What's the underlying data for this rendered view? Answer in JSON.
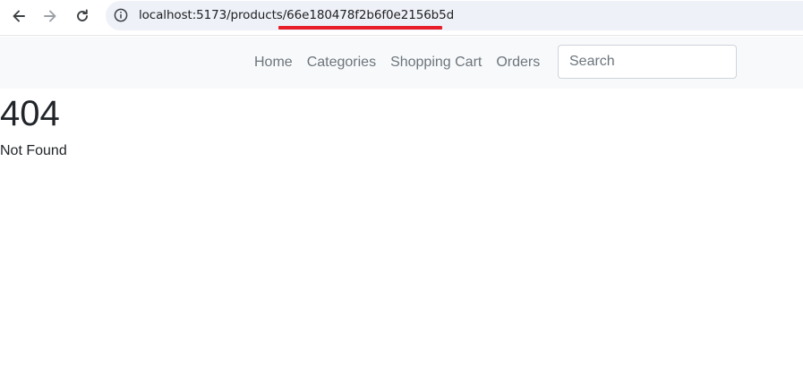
{
  "browser": {
    "url": "localhost:5173/products/66e180478f2b6f0e2156b5d",
    "icons": {
      "back": "arrow-left-icon",
      "forward": "arrow-right-icon",
      "reload": "reload-icon",
      "site_info": "info-circle-icon"
    },
    "highlight_color": "#e81e28"
  },
  "navbar": {
    "links": [
      "Home",
      "Categories",
      "Shopping Cart",
      "Orders"
    ],
    "search_placeholder": "Search"
  },
  "main": {
    "error_code": "404",
    "error_message": "Not Found"
  }
}
